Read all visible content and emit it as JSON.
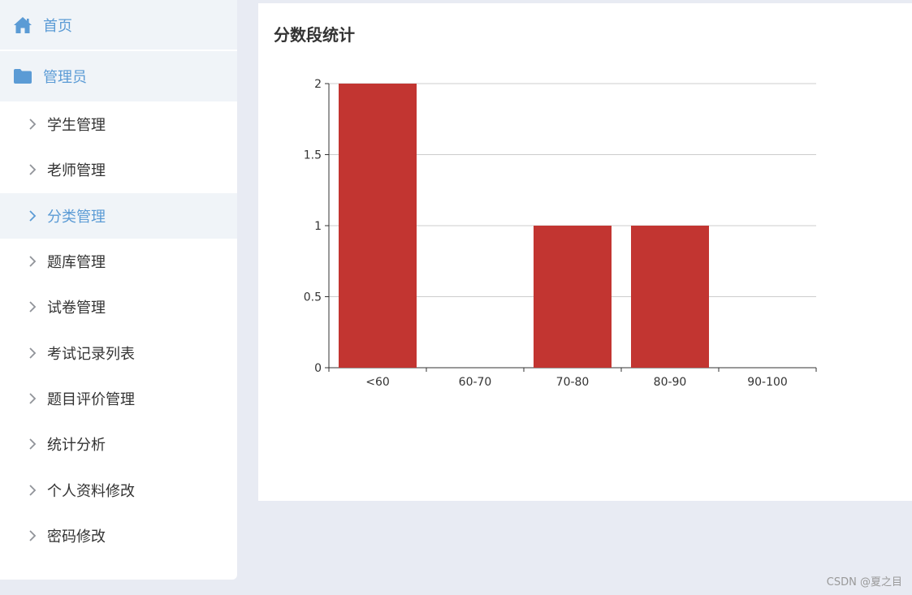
{
  "sidebar": {
    "home": {
      "label": "首页",
      "icon": "home-icon"
    },
    "admin": {
      "label": "管理员",
      "icon": "folder-icon"
    },
    "items": [
      {
        "label": "学生管理",
        "active": false
      },
      {
        "label": "老师管理",
        "active": false
      },
      {
        "label": "分类管理",
        "active": true
      },
      {
        "label": "题库管理",
        "active": false
      },
      {
        "label": "试卷管理",
        "active": false
      },
      {
        "label": "考试记录列表",
        "active": false
      },
      {
        "label": "题目评价管理",
        "active": false
      },
      {
        "label": "统计分析",
        "active": false
      },
      {
        "label": "个人资料修改",
        "active": false
      },
      {
        "label": "密码修改",
        "active": false
      }
    ]
  },
  "main": {
    "title": "分数段统计"
  },
  "colors": {
    "accent": "#5b9bd5",
    "bar": "#c23531",
    "background": "#e8ebf3"
  },
  "chart_data": {
    "type": "bar",
    "title": "分数段统计",
    "categories": [
      "<60",
      "60-70",
      "70-80",
      "80-90",
      "90-100"
    ],
    "values": [
      2,
      0,
      1,
      1,
      0
    ],
    "ylim": [
      0,
      2
    ],
    "yticks": [
      "0",
      "0.5",
      "1",
      "1.5",
      "2"
    ],
    "xlabel": "",
    "ylabel": "",
    "grid": true,
    "color": "#c23531"
  },
  "watermark": "CSDN @夏之目"
}
